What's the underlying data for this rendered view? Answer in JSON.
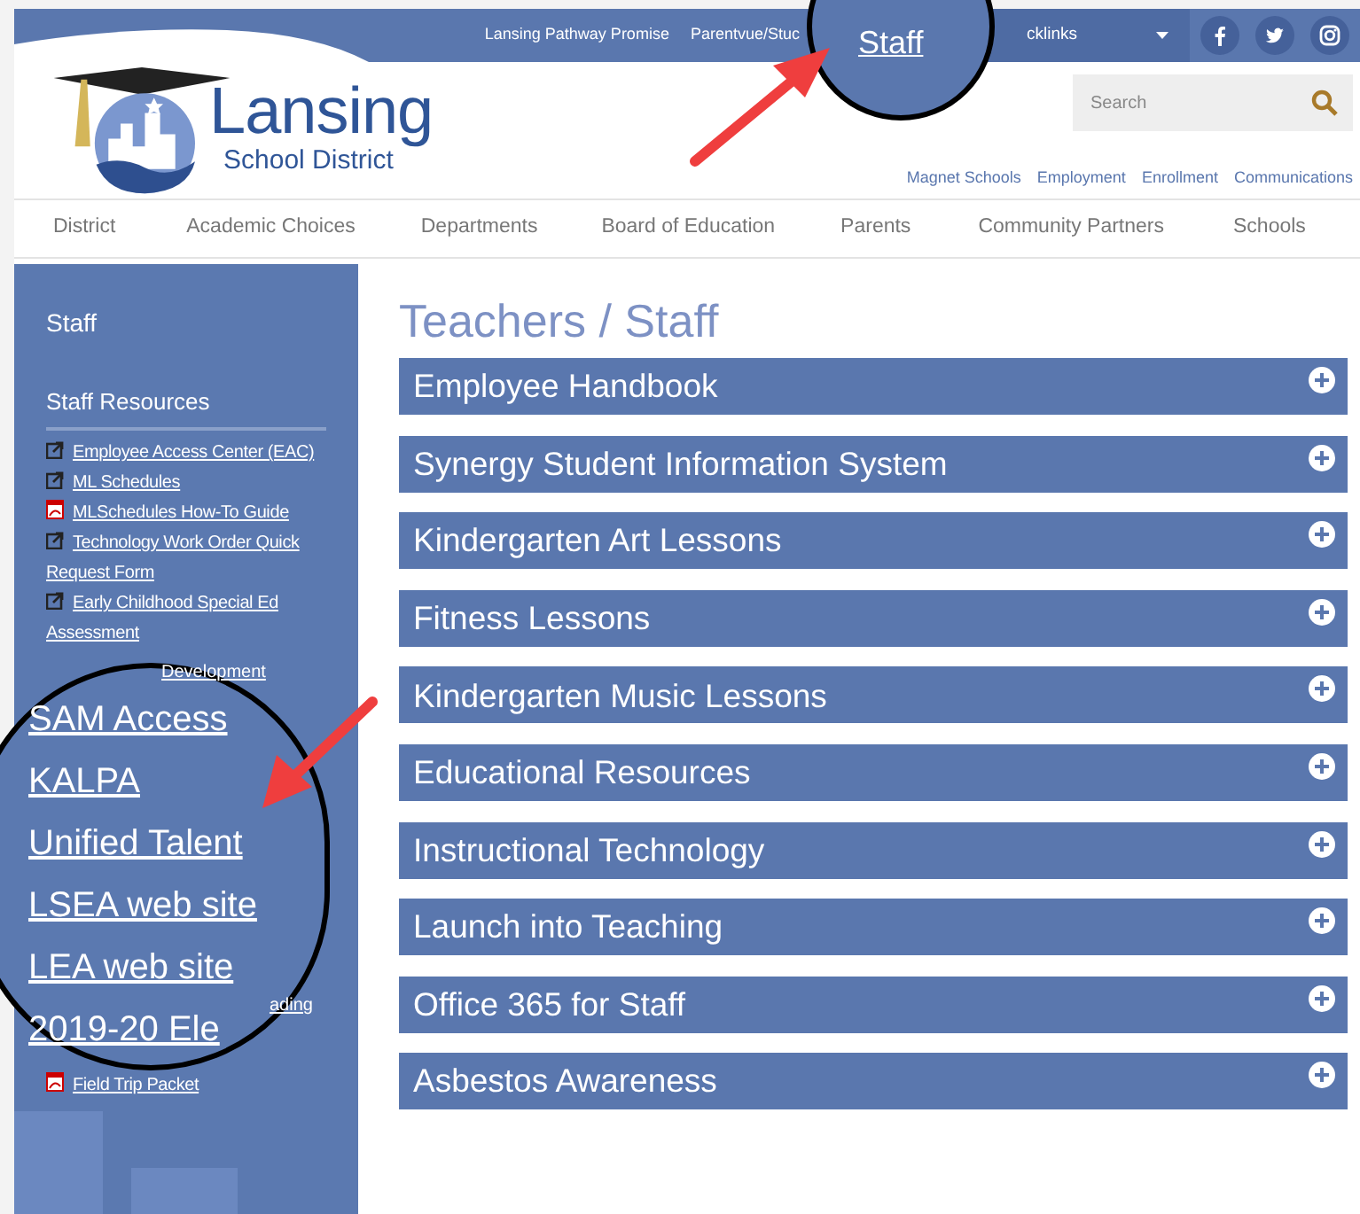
{
  "top_bar": {
    "links": [
      "Lansing Pathway Promise",
      "Parentvue/Stuc"
    ],
    "quicklinks": "cklinks"
  },
  "staff_callout": {
    "label": "Staff"
  },
  "logo": {
    "name": "Lansing",
    "subtitle": "School District"
  },
  "search": {
    "placeholder": "Search"
  },
  "utility_links": [
    "Magnet Schools",
    "Employment",
    "Enrollment",
    "Communications"
  ],
  "nav": [
    "District",
    "Academic Choices",
    "Departments",
    "Board of Education",
    "Parents",
    "Community Partners",
    "Schools"
  ],
  "sidebar": {
    "title": "Staff",
    "section": "Staff Resources",
    "links": [
      {
        "kind": "external",
        "text": "Employee Access Center (EAC)"
      },
      {
        "kind": "external",
        "text": "ML Schedules"
      },
      {
        "kind": "pdf",
        "text": "MLSchedules How-To Guide"
      },
      {
        "kind": "external",
        "text": "Technology Work Order Quick Request Form"
      },
      {
        "kind": "external",
        "text": "Early Childhood Special Ed Assessment"
      },
      {
        "kind": "fragment",
        "text": "Development"
      }
    ],
    "hidden_fragments": [
      "ading"
    ],
    "bottom_links": [
      {
        "kind": "pdf",
        "text": "Field Trip Packet"
      }
    ]
  },
  "magnifier": {
    "links": [
      "SAM Access",
      "KALPA",
      "Unified Talent",
      "LSEA web site",
      "LEA web site",
      "2019-20 Ele"
    ]
  },
  "page_title": "Teachers / Staff",
  "accordion": [
    {
      "title": "Employee Handbook",
      "expanded": false
    },
    {
      "title": "Synergy Student Information System",
      "expanded": false
    },
    {
      "title": "Kindergarten Art Lessons",
      "expanded": false
    },
    {
      "title": "Fitness Lessons",
      "expanded": false
    },
    {
      "title": "Kindergarten Music Lessons",
      "expanded": false
    },
    {
      "title": "Educational Resources",
      "expanded": false
    },
    {
      "title": "Instructional Technology",
      "expanded": false
    },
    {
      "title": "Launch into Teaching",
      "expanded": false
    },
    {
      "title": "Office 365 for Staff",
      "expanded": false
    },
    {
      "title": "Asbestos Awareness",
      "expanded": false
    }
  ]
}
